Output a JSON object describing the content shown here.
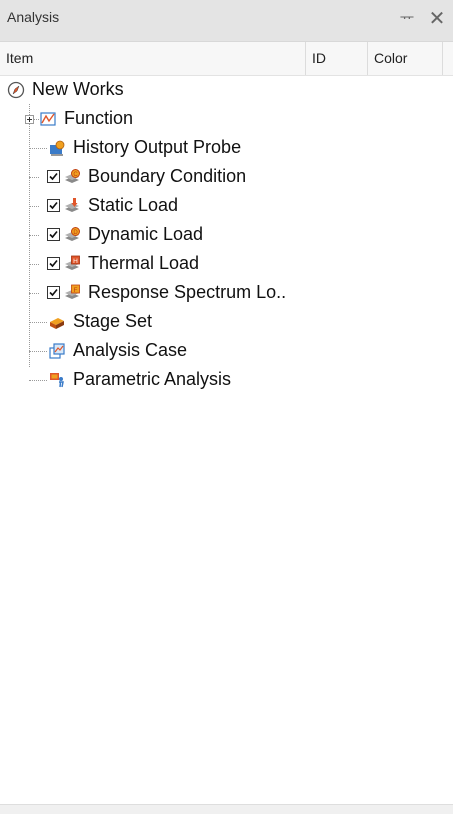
{
  "panel": {
    "title": "Analysis",
    "pin_glyph": "ᅲ",
    "close_glyph": "✕"
  },
  "columns": {
    "item": "Item",
    "id": "ID",
    "color": "Color"
  },
  "tree": {
    "root": {
      "label": "New Works",
      "icon": "compass-icon"
    },
    "items": [
      {
        "label": "Function",
        "icon": "function-graph-icon",
        "expandable": true,
        "checkbox": false
      },
      {
        "label": "History Output Probe",
        "icon": "history-probe-icon",
        "checkbox": false
      },
      {
        "label": "Boundary Condition",
        "icon": "boundary-condition-icon",
        "checkbox": true,
        "checked": true
      },
      {
        "label": "Static Load",
        "icon": "static-load-icon",
        "checkbox": true,
        "checked": true
      },
      {
        "label": "Dynamic Load",
        "icon": "dynamic-load-icon",
        "checkbox": true,
        "checked": true
      },
      {
        "label": "Thermal Load",
        "icon": "thermal-load-icon",
        "checkbox": true,
        "checked": true
      },
      {
        "label": "Response Spectrum Lo..",
        "icon": "response-spectrum-icon",
        "checkbox": true,
        "checked": true
      },
      {
        "label": "Stage Set",
        "icon": "stage-set-icon",
        "checkbox": false
      },
      {
        "label": "Analysis Case",
        "icon": "analysis-case-icon",
        "checkbox": false
      },
      {
        "label": "Parametric Analysis",
        "icon": "parametric-analysis-icon",
        "checkbox": false
      }
    ]
  },
  "colors": {
    "accent_red": "#e0562a",
    "accent_blue": "#3a7bc8",
    "accent_orange": "#f0a020"
  }
}
